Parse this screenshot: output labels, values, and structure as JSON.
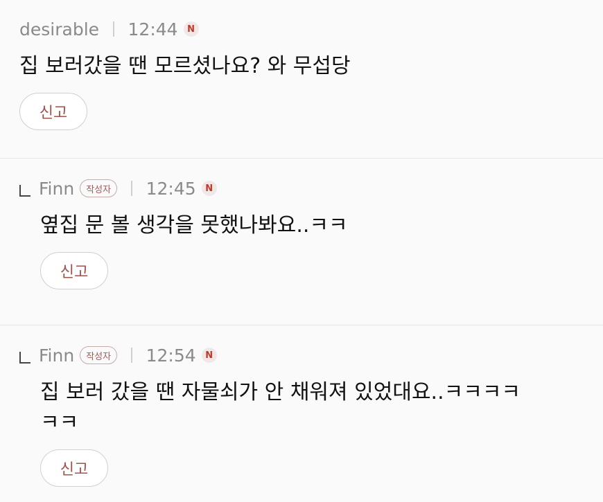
{
  "comments": [
    {
      "author": "desirable",
      "time": "12:44",
      "new_badge": "N",
      "text": "집 보러갔을 땐 모르셨나요? 와 무섭당",
      "report_label": "신고"
    },
    {
      "author": "Finn",
      "author_badge": "작성자",
      "time": "12:45",
      "new_badge": "N",
      "text": "옆집 문 볼 생각을 못했나봐요..ㅋㅋ",
      "report_label": "신고"
    },
    {
      "author": "Finn",
      "author_badge": "작성자",
      "time": "12:54",
      "new_badge": "N",
      "text_line1": "집 보러 갔을 땐 자물쇠가 안 채워져 있었대요..ㅋㅋㅋㅋ",
      "text_line2": "ㅋㅋ",
      "report_label": "신고"
    }
  ],
  "colors": {
    "background": "#fafafa",
    "meta_text": "#8a8a8a",
    "report_text": "#a0524c",
    "new_badge": "#c0392b"
  },
  "icons": {
    "new_badge": "new-n-icon",
    "reply": "reply-arrow-icon"
  }
}
